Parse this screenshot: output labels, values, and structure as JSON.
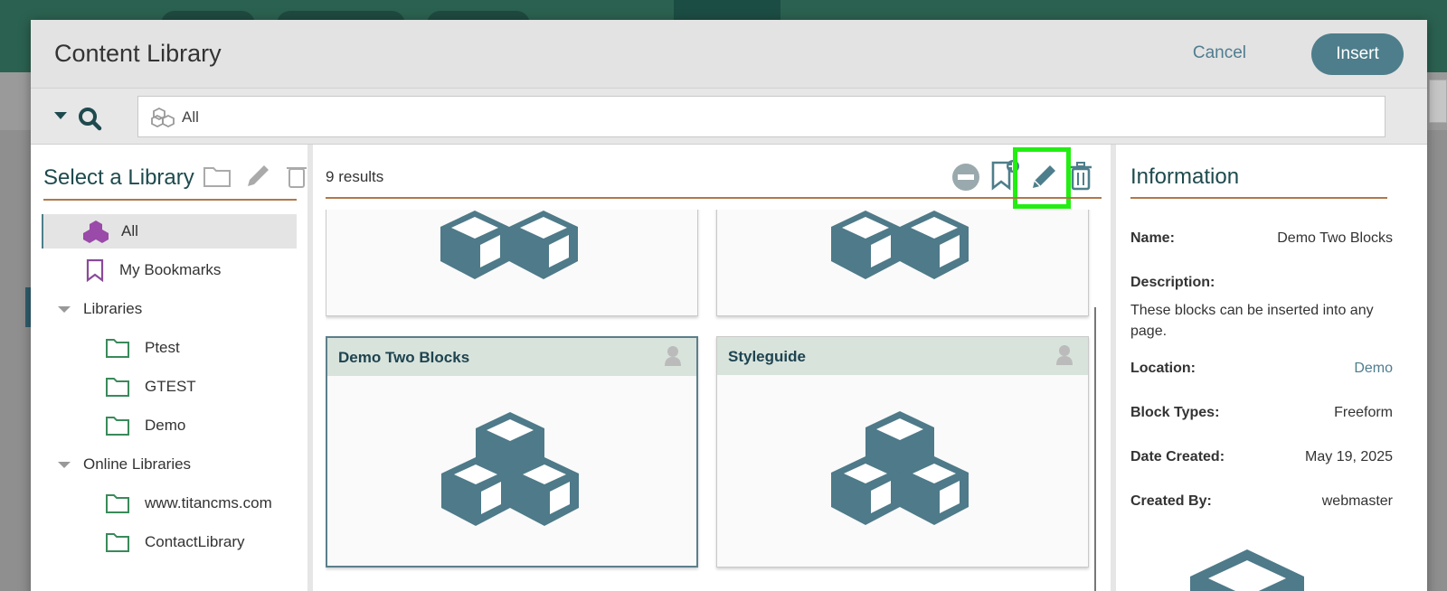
{
  "dialog": {
    "title": "Content Library",
    "cancel_label": "Cancel",
    "insert_label": "Insert"
  },
  "search": {
    "scope_text": "All"
  },
  "library_panel": {
    "heading": "Select a Library",
    "items": [
      {
        "label": "All",
        "icon": "blocks-icon",
        "selected": true
      },
      {
        "label": "My Bookmarks",
        "icon": "bookmark-icon"
      },
      {
        "label": "Libraries",
        "icon": "caret-down-icon",
        "group": true
      },
      {
        "label": "Ptest",
        "icon": "folder-icon"
      },
      {
        "label": "GTEST",
        "icon": "folder-icon"
      },
      {
        "label": "Demo",
        "icon": "folder-icon"
      },
      {
        "label": "Online Libraries",
        "icon": "caret-down-icon",
        "group": true
      },
      {
        "label": "www.titancms.com",
        "icon": "folder-icon"
      },
      {
        "label": "ContactLibrary",
        "icon": "folder-icon"
      }
    ]
  },
  "results": {
    "count_number": "9",
    "count_label": "results",
    "tiles": [
      {
        "title": "Demo Two Blocks",
        "selected": true
      },
      {
        "title": "Styleguide",
        "selected": false
      }
    ]
  },
  "info": {
    "heading": "Information",
    "name_label": "Name:",
    "name_value": "Demo Two Blocks",
    "description_label": "Description:",
    "description_value": "These blocks can be inserted into any page.",
    "location_label": "Location:",
    "location_value": "Demo",
    "block_types_label": "Block Types:",
    "block_types_value": "Freeform",
    "date_created_label": "Date Created:",
    "date_created_value": "May 19, 2025",
    "created_by_label": "Created By:",
    "created_by_value": "webmaster"
  },
  "colors": {
    "accent": "#4e7e8b",
    "header_bar": "#2b6150",
    "rule": "#b0784a",
    "highlight": "#22ee11",
    "folder": "#3a8a5a",
    "bookmark": "#8a4a9a"
  }
}
